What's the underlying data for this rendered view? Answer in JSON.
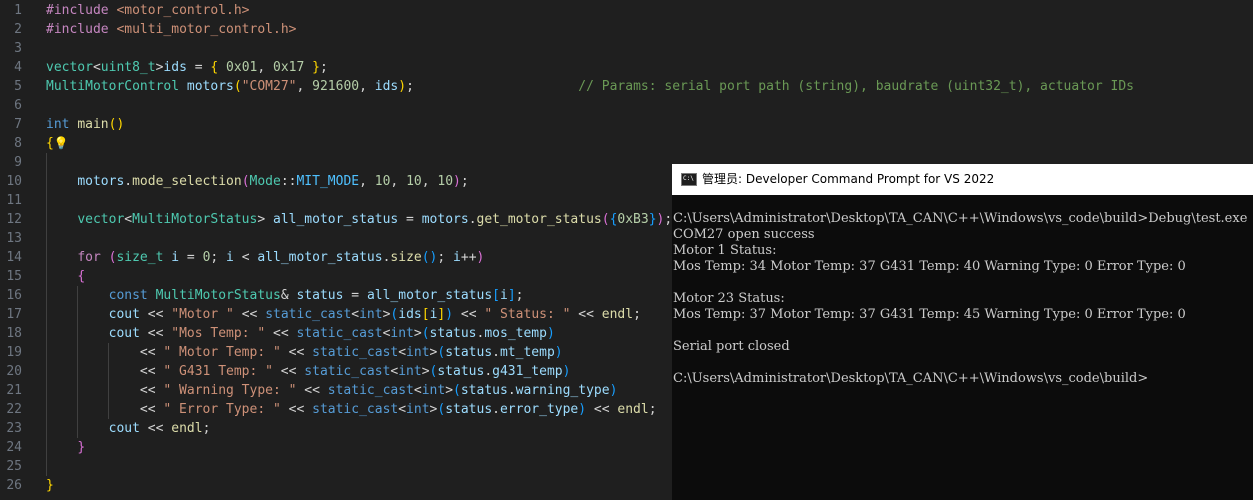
{
  "editor": {
    "lines": [
      {
        "n": "1",
        "indent": 0,
        "tokens": [
          {
            "t": "#include",
            "c": "t-prep"
          },
          {
            "t": " ",
            "c": "t-txt"
          },
          {
            "t": "<motor_control.h>",
            "c": "t-str"
          }
        ]
      },
      {
        "n": "2",
        "indent": 0,
        "tokens": [
          {
            "t": "#include",
            "c": "t-prep"
          },
          {
            "t": " ",
            "c": "t-txt"
          },
          {
            "t": "<multi_motor_control.h>",
            "c": "t-str"
          }
        ]
      },
      {
        "n": "3",
        "indent": 0,
        "tokens": []
      },
      {
        "n": "4",
        "indent": 0,
        "tokens": [
          {
            "t": "vector",
            "c": "t-type"
          },
          {
            "t": "<",
            "c": "t-txt"
          },
          {
            "t": "uint8_t",
            "c": "t-type"
          },
          {
            "t": ">",
            "c": "t-txt"
          },
          {
            "t": "ids",
            "c": "t-var"
          },
          {
            "t": " = ",
            "c": "t-txt"
          },
          {
            "t": "{",
            "c": "t-b1"
          },
          {
            "t": " ",
            "c": "t-txt"
          },
          {
            "t": "0x01",
            "c": "t-num"
          },
          {
            "t": ", ",
            "c": "t-txt"
          },
          {
            "t": "0x17",
            "c": "t-num"
          },
          {
            "t": " ",
            "c": "t-txt"
          },
          {
            "t": "}",
            "c": "t-b1"
          },
          {
            "t": ";",
            "c": "t-txt"
          }
        ]
      },
      {
        "n": "5",
        "indent": 0,
        "tokens": [
          {
            "t": "MultiMotorControl",
            "c": "t-type"
          },
          {
            "t": " ",
            "c": "t-txt"
          },
          {
            "t": "motors",
            "c": "t-var"
          },
          {
            "t": "(",
            "c": "t-b1"
          },
          {
            "t": "\"COM27\"",
            "c": "t-str"
          },
          {
            "t": ", ",
            "c": "t-txt"
          },
          {
            "t": "921600",
            "c": "t-num"
          },
          {
            "t": ", ",
            "c": "t-txt"
          },
          {
            "t": "ids",
            "c": "t-var"
          },
          {
            "t": ")",
            "c": "t-b1"
          },
          {
            "t": ";",
            "c": "t-txt"
          },
          {
            "t": "                     ",
            "c": "t-txt"
          },
          {
            "t": "// Params: serial port path (string), baudrate (uint32_t), actuator IDs",
            "c": "t-cm"
          }
        ]
      },
      {
        "n": "6",
        "indent": 0,
        "tokens": []
      },
      {
        "n": "7",
        "indent": 0,
        "tokens": [
          {
            "t": "int",
            "c": "t-kw"
          },
          {
            "t": " ",
            "c": "t-txt"
          },
          {
            "t": "main",
            "c": "t-fn"
          },
          {
            "t": "()",
            "c": "t-b1"
          }
        ]
      },
      {
        "n": "8",
        "indent": 0,
        "bulb": true,
        "tokens": [
          {
            "t": "{",
            "c": "t-b1"
          }
        ]
      },
      {
        "n": "9",
        "indent": 1,
        "tokens": []
      },
      {
        "n": "10",
        "indent": 1,
        "tokens": [
          {
            "t": "    ",
            "c": "t-txt"
          },
          {
            "t": "motors",
            "c": "t-var"
          },
          {
            "t": ".",
            "c": "t-txt"
          },
          {
            "t": "mode_selection",
            "c": "t-fn"
          },
          {
            "t": "(",
            "c": "t-b2"
          },
          {
            "t": "Mode",
            "c": "t-type"
          },
          {
            "t": "::",
            "c": "t-txt"
          },
          {
            "t": "MIT_MODE",
            "c": "t-enum"
          },
          {
            "t": ", ",
            "c": "t-txt"
          },
          {
            "t": "10",
            "c": "t-num"
          },
          {
            "t": ", ",
            "c": "t-txt"
          },
          {
            "t": "10",
            "c": "t-num"
          },
          {
            "t": ", ",
            "c": "t-txt"
          },
          {
            "t": "10",
            "c": "t-num"
          },
          {
            "t": ")",
            "c": "t-b2"
          },
          {
            "t": ";",
            "c": "t-txt"
          }
        ]
      },
      {
        "n": "11",
        "indent": 1,
        "tokens": []
      },
      {
        "n": "12",
        "indent": 1,
        "tokens": [
          {
            "t": "    ",
            "c": "t-txt"
          },
          {
            "t": "vector",
            "c": "t-type"
          },
          {
            "t": "<",
            "c": "t-txt"
          },
          {
            "t": "MultiMotorStatus",
            "c": "t-type"
          },
          {
            "t": "> ",
            "c": "t-txt"
          },
          {
            "t": "all_motor_status",
            "c": "t-var"
          },
          {
            "t": " = ",
            "c": "t-txt"
          },
          {
            "t": "motors",
            "c": "t-var"
          },
          {
            "t": ".",
            "c": "t-txt"
          },
          {
            "t": "get_motor_status",
            "c": "t-fn"
          },
          {
            "t": "(",
            "c": "t-b2"
          },
          {
            "t": "{",
            "c": "t-b3"
          },
          {
            "t": "0xB3",
            "c": "t-num"
          },
          {
            "t": "}",
            "c": "t-b3"
          },
          {
            "t": ")",
            "c": "t-b2"
          },
          {
            "t": ";",
            "c": "t-txt"
          }
        ]
      },
      {
        "n": "13",
        "indent": 1,
        "tokens": []
      },
      {
        "n": "14",
        "indent": 1,
        "tokens": [
          {
            "t": "    ",
            "c": "t-txt"
          },
          {
            "t": "for",
            "c": "t-ctl"
          },
          {
            "t": " ",
            "c": "t-txt"
          },
          {
            "t": "(",
            "c": "t-b2"
          },
          {
            "t": "size_t",
            "c": "t-type"
          },
          {
            "t": " ",
            "c": "t-txt"
          },
          {
            "t": "i",
            "c": "t-var"
          },
          {
            "t": " = ",
            "c": "t-txt"
          },
          {
            "t": "0",
            "c": "t-num"
          },
          {
            "t": "; ",
            "c": "t-txt"
          },
          {
            "t": "i",
            "c": "t-var"
          },
          {
            "t": " < ",
            "c": "t-txt"
          },
          {
            "t": "all_motor_status",
            "c": "t-var"
          },
          {
            "t": ".",
            "c": "t-txt"
          },
          {
            "t": "size",
            "c": "t-fn"
          },
          {
            "t": "()",
            "c": "t-b3"
          },
          {
            "t": "; ",
            "c": "t-txt"
          },
          {
            "t": "i",
            "c": "t-var"
          },
          {
            "t": "++",
            "c": "t-txt"
          },
          {
            "t": ")",
            "c": "t-b2"
          }
        ]
      },
      {
        "n": "15",
        "indent": 1,
        "tokens": [
          {
            "t": "    ",
            "c": "t-txt"
          },
          {
            "t": "{",
            "c": "t-b2"
          }
        ]
      },
      {
        "n": "16",
        "indent": 2,
        "tokens": [
          {
            "t": "        ",
            "c": "t-txt"
          },
          {
            "t": "const",
            "c": "t-kw"
          },
          {
            "t": " ",
            "c": "t-txt"
          },
          {
            "t": "MultiMotorStatus",
            "c": "t-type"
          },
          {
            "t": "& ",
            "c": "t-txt"
          },
          {
            "t": "status",
            "c": "t-var"
          },
          {
            "t": " = ",
            "c": "t-txt"
          },
          {
            "t": "all_motor_status",
            "c": "t-var"
          },
          {
            "t": "[",
            "c": "t-b3"
          },
          {
            "t": "i",
            "c": "t-var"
          },
          {
            "t": "]",
            "c": "t-b3"
          },
          {
            "t": ";",
            "c": "t-txt"
          }
        ]
      },
      {
        "n": "17",
        "indent": 2,
        "tokens": [
          {
            "t": "        ",
            "c": "t-txt"
          },
          {
            "t": "cout",
            "c": "t-var"
          },
          {
            "t": " << ",
            "c": "t-txt"
          },
          {
            "t": "\"Motor \"",
            "c": "t-str"
          },
          {
            "t": " << ",
            "c": "t-txt"
          },
          {
            "t": "static_cast",
            "c": "t-kw"
          },
          {
            "t": "<",
            "c": "t-txt"
          },
          {
            "t": "int",
            "c": "t-kw"
          },
          {
            "t": ">",
            "c": "t-txt"
          },
          {
            "t": "(",
            "c": "t-b3"
          },
          {
            "t": "ids",
            "c": "t-var"
          },
          {
            "t": "[",
            "c": "t-b1"
          },
          {
            "t": "i",
            "c": "t-var"
          },
          {
            "t": "]",
            "c": "t-b1"
          },
          {
            "t": ")",
            "c": "t-b3"
          },
          {
            "t": " << ",
            "c": "t-txt"
          },
          {
            "t": "\" Status: \"",
            "c": "t-str"
          },
          {
            "t": " << ",
            "c": "t-txt"
          },
          {
            "t": "endl",
            "c": "t-fn"
          },
          {
            "t": ";",
            "c": "t-txt"
          }
        ]
      },
      {
        "n": "18",
        "indent": 2,
        "tokens": [
          {
            "t": "        ",
            "c": "t-txt"
          },
          {
            "t": "cout",
            "c": "t-var"
          },
          {
            "t": " << ",
            "c": "t-txt"
          },
          {
            "t": "\"Mos Temp: \"",
            "c": "t-str"
          },
          {
            "t": " << ",
            "c": "t-txt"
          },
          {
            "t": "static_cast",
            "c": "t-kw"
          },
          {
            "t": "<",
            "c": "t-txt"
          },
          {
            "t": "int",
            "c": "t-kw"
          },
          {
            "t": ">",
            "c": "t-txt"
          },
          {
            "t": "(",
            "c": "t-b3"
          },
          {
            "t": "status",
            "c": "t-var"
          },
          {
            "t": ".",
            "c": "t-txt"
          },
          {
            "t": "mos_temp",
            "c": "t-var"
          },
          {
            "t": ")",
            "c": "t-b3"
          }
        ]
      },
      {
        "n": "19",
        "indent": 3,
        "tokens": [
          {
            "t": "            ",
            "c": "t-txt"
          },
          {
            "t": "<< ",
            "c": "t-txt"
          },
          {
            "t": "\" Motor Temp: \"",
            "c": "t-str"
          },
          {
            "t": " << ",
            "c": "t-txt"
          },
          {
            "t": "static_cast",
            "c": "t-kw"
          },
          {
            "t": "<",
            "c": "t-txt"
          },
          {
            "t": "int",
            "c": "t-kw"
          },
          {
            "t": ">",
            "c": "t-txt"
          },
          {
            "t": "(",
            "c": "t-b3"
          },
          {
            "t": "status",
            "c": "t-var"
          },
          {
            "t": ".",
            "c": "t-txt"
          },
          {
            "t": "mt_temp",
            "c": "t-var"
          },
          {
            "t": ")",
            "c": "t-b3"
          }
        ]
      },
      {
        "n": "20",
        "indent": 3,
        "tokens": [
          {
            "t": "            ",
            "c": "t-txt"
          },
          {
            "t": "<< ",
            "c": "t-txt"
          },
          {
            "t": "\" G431 Temp: \"",
            "c": "t-str"
          },
          {
            "t": " << ",
            "c": "t-txt"
          },
          {
            "t": "static_cast",
            "c": "t-kw"
          },
          {
            "t": "<",
            "c": "t-txt"
          },
          {
            "t": "int",
            "c": "t-kw"
          },
          {
            "t": ">",
            "c": "t-txt"
          },
          {
            "t": "(",
            "c": "t-b3"
          },
          {
            "t": "status",
            "c": "t-var"
          },
          {
            "t": ".",
            "c": "t-txt"
          },
          {
            "t": "g431_temp",
            "c": "t-var"
          },
          {
            "t": ")",
            "c": "t-b3"
          }
        ]
      },
      {
        "n": "21",
        "indent": 3,
        "tokens": [
          {
            "t": "            ",
            "c": "t-txt"
          },
          {
            "t": "<< ",
            "c": "t-txt"
          },
          {
            "t": "\" Warning Type: \"",
            "c": "t-str"
          },
          {
            "t": " << ",
            "c": "t-txt"
          },
          {
            "t": "static_cast",
            "c": "t-kw"
          },
          {
            "t": "<",
            "c": "t-txt"
          },
          {
            "t": "int",
            "c": "t-kw"
          },
          {
            "t": ">",
            "c": "t-txt"
          },
          {
            "t": "(",
            "c": "t-b3"
          },
          {
            "t": "status",
            "c": "t-var"
          },
          {
            "t": ".",
            "c": "t-txt"
          },
          {
            "t": "warning_type",
            "c": "t-var"
          },
          {
            "t": ")",
            "c": "t-b3"
          }
        ]
      },
      {
        "n": "22",
        "indent": 3,
        "tokens": [
          {
            "t": "            ",
            "c": "t-txt"
          },
          {
            "t": "<< ",
            "c": "t-txt"
          },
          {
            "t": "\" Error Type: \"",
            "c": "t-str"
          },
          {
            "t": " << ",
            "c": "t-txt"
          },
          {
            "t": "static_cast",
            "c": "t-kw"
          },
          {
            "t": "<",
            "c": "t-txt"
          },
          {
            "t": "int",
            "c": "t-kw"
          },
          {
            "t": ">",
            "c": "t-txt"
          },
          {
            "t": "(",
            "c": "t-b3"
          },
          {
            "t": "status",
            "c": "t-var"
          },
          {
            "t": ".",
            "c": "t-txt"
          },
          {
            "t": "error_type",
            "c": "t-var"
          },
          {
            "t": ")",
            "c": "t-b3"
          },
          {
            "t": " << ",
            "c": "t-txt"
          },
          {
            "t": "endl",
            "c": "t-fn"
          },
          {
            "t": ";",
            "c": "t-txt"
          }
        ]
      },
      {
        "n": "23",
        "indent": 2,
        "tokens": [
          {
            "t": "        ",
            "c": "t-txt"
          },
          {
            "t": "cout",
            "c": "t-var"
          },
          {
            "t": " << ",
            "c": "t-txt"
          },
          {
            "t": "endl",
            "c": "t-fn"
          },
          {
            "t": ";",
            "c": "t-txt"
          }
        ]
      },
      {
        "n": "24",
        "indent": 1,
        "tokens": [
          {
            "t": "    ",
            "c": "t-txt"
          },
          {
            "t": "}",
            "c": "t-b2"
          }
        ]
      },
      {
        "n": "25",
        "indent": 1,
        "tokens": []
      },
      {
        "n": "26",
        "indent": 0,
        "tokens": [
          {
            "t": "}",
            "c": "t-b1"
          }
        ]
      }
    ]
  },
  "terminal": {
    "icon_label": "C:\\",
    "title": "管理员: Developer Command Prompt for VS 2022",
    "lines": [
      "C:\\Users\\Administrator\\Desktop\\TA_CAN\\C++\\Windows\\vs_code\\build>Debug\\test.exe",
      "COM27 open success",
      "Motor 1 Status:",
      "Mos Temp: 34 Motor Temp: 37 G431 Temp: 40 Warning Type: 0 Error Type: 0",
      "",
      "Motor 23 Status:",
      "Mos Temp: 37 Motor Temp: 37 G431 Temp: 45 Warning Type: 0 Error Type: 0",
      "",
      "Serial port closed",
      "",
      "C:\\Users\\Administrator\\Desktop\\TA_CAN\\C++\\Windows\\vs_code\\build>"
    ]
  },
  "colors": {
    "editor_bg": "#1f1f1f",
    "line_number": "#6e7681",
    "terminal_bg": "#0c0c0c",
    "terminal_text": "#cccccc",
    "titlebar_bg": "#ffffff"
  },
  "icons": {
    "lightbulb": "lightbulb-icon",
    "console": "console-icon"
  }
}
